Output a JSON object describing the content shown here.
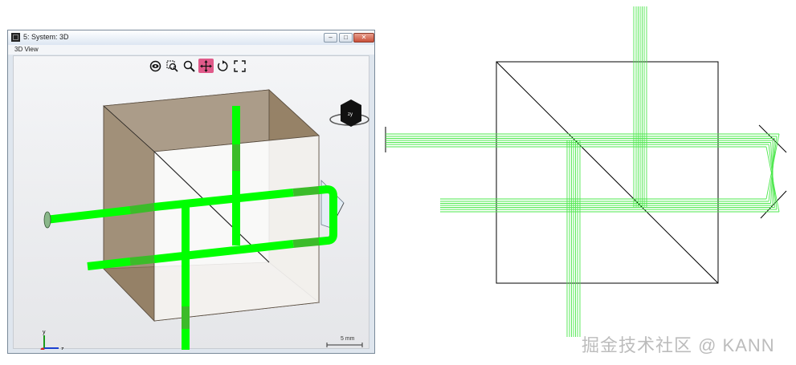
{
  "window": {
    "title": "5: System: 3D",
    "controls": {
      "minimize": "–",
      "maximize": "□",
      "close": "✕"
    }
  },
  "menu": {
    "view_label": "3D View"
  },
  "toolbar": {
    "tools": [
      {
        "icon": "eye-icon",
        "label": "view"
      },
      {
        "icon": "zoom-window-icon",
        "label": "zoom window"
      },
      {
        "icon": "zoom-icon",
        "label": "zoom"
      },
      {
        "icon": "pan-icon",
        "label": "pan",
        "active": true
      },
      {
        "icon": "rotate-icon",
        "label": "rotate"
      },
      {
        "icon": "fit-icon",
        "label": "fit"
      }
    ]
  },
  "orientation_cube": {
    "face_label": "zy"
  },
  "axes": {
    "y": "y",
    "z": "z"
  },
  "scale_bar": {
    "label": "5 mm"
  },
  "colors": {
    "beam": "#00ff00",
    "beam_inside": "#33bb22",
    "cube_face": "#8a7356",
    "diagram_beam": "#4de84d",
    "active_tool": "#e05a8a"
  },
  "watermark": {
    "text": "掘金技术社区 @ KANN"
  }
}
